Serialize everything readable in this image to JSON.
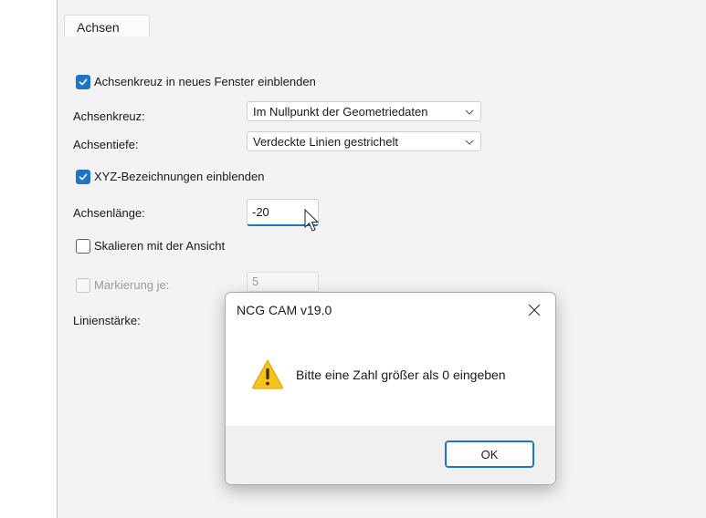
{
  "tab": {
    "label": "Achsen"
  },
  "options": {
    "show_axes_new_window": {
      "label": "Achsenkreuz in neues Fenster einblenden",
      "checked": true
    },
    "axis_cross": {
      "label": "Achsenkreuz:",
      "value": "Im Nullpunkt der Geometriedaten"
    },
    "axis_depth": {
      "label": "Achsentiefe:",
      "value": "Verdeckte Linien gestrichelt"
    },
    "xyz_labels": {
      "label": "XYZ-Bezeichnungen einblenden",
      "checked": true
    },
    "axis_length": {
      "label": "Achsenlänge:",
      "value": "-20"
    },
    "scale_with_view": {
      "label": "Skalieren mit der Ansicht",
      "checked": false
    },
    "marking_each": {
      "label": "Markierung je:",
      "value": "5",
      "checked": false,
      "disabled": true
    },
    "line_width": {
      "label": "Linienstärke:"
    }
  },
  "dialog": {
    "title": "NCG CAM v19.0",
    "message": "Bitte eine Zahl größer als 0 eingeben",
    "ok_label": "OK",
    "icon": "warning-icon",
    "close_icon": "close-icon"
  },
  "colors": {
    "accent": "#1f74c8",
    "warning": "#f6c21c"
  }
}
